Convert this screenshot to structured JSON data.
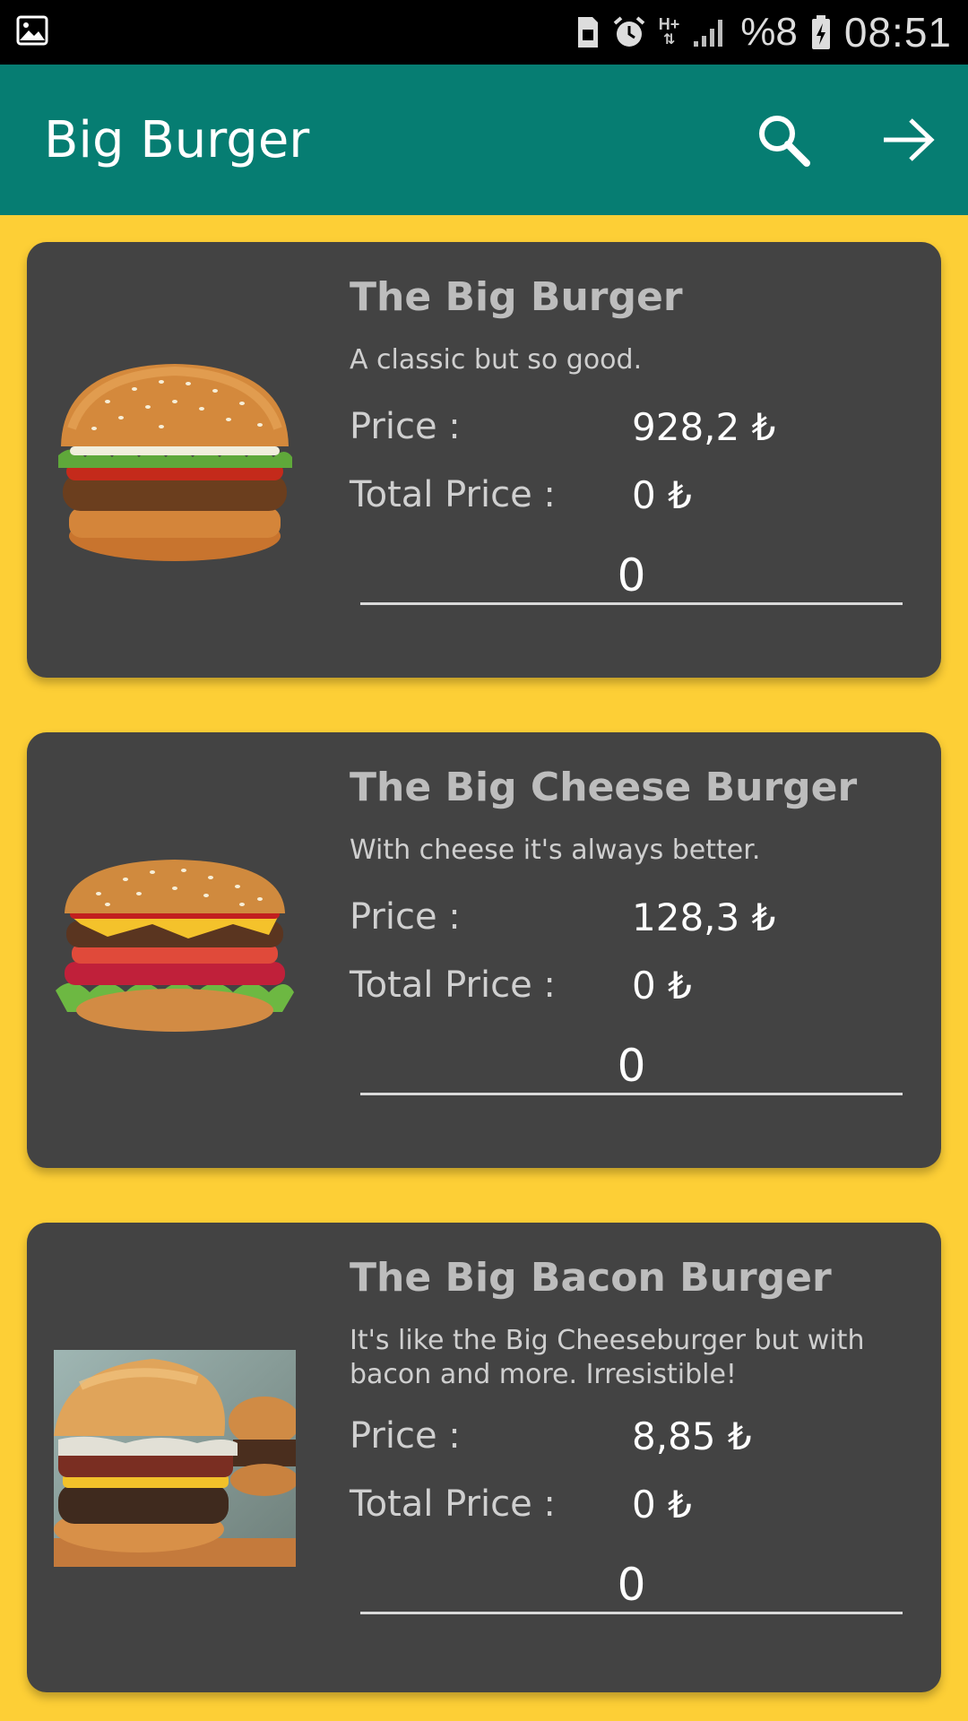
{
  "status_bar": {
    "battery_text": "%8",
    "time": "08:51",
    "network": "H+",
    "icons": [
      "image-icon",
      "sim-card-icon",
      "alarm-icon",
      "network-icon",
      "signal-icon",
      "battery-icon"
    ]
  },
  "app_bar": {
    "title": "Big Burger",
    "actions": [
      "search-icon",
      "arrow-right-icon"
    ],
    "color": "#067D72"
  },
  "theme": {
    "background": "#FDCF36",
    "card": "#434343"
  },
  "labels": {
    "price": "Price :",
    "total_price": "Total Price :"
  },
  "products": [
    {
      "name": "The Big Burger",
      "description": "A classic but so good.",
      "price": "928,2 ₺",
      "total_price": "0 ₺",
      "quantity": "0",
      "image": "classic-burger-image"
    },
    {
      "name": "The Big Cheese Burger",
      "description": "With cheese it's always better.",
      "price": "128,3 ₺",
      "total_price": "0 ₺",
      "quantity": "0",
      "image": "cheese-burger-image"
    },
    {
      "name": "The Big Bacon Burger",
      "description": "It's like the Big Cheeseburger but with bacon and more. Irresistible!",
      "price": "8,85 ₺",
      "total_price": "0 ₺",
      "quantity": "0",
      "image": "bacon-burger-image"
    }
  ]
}
